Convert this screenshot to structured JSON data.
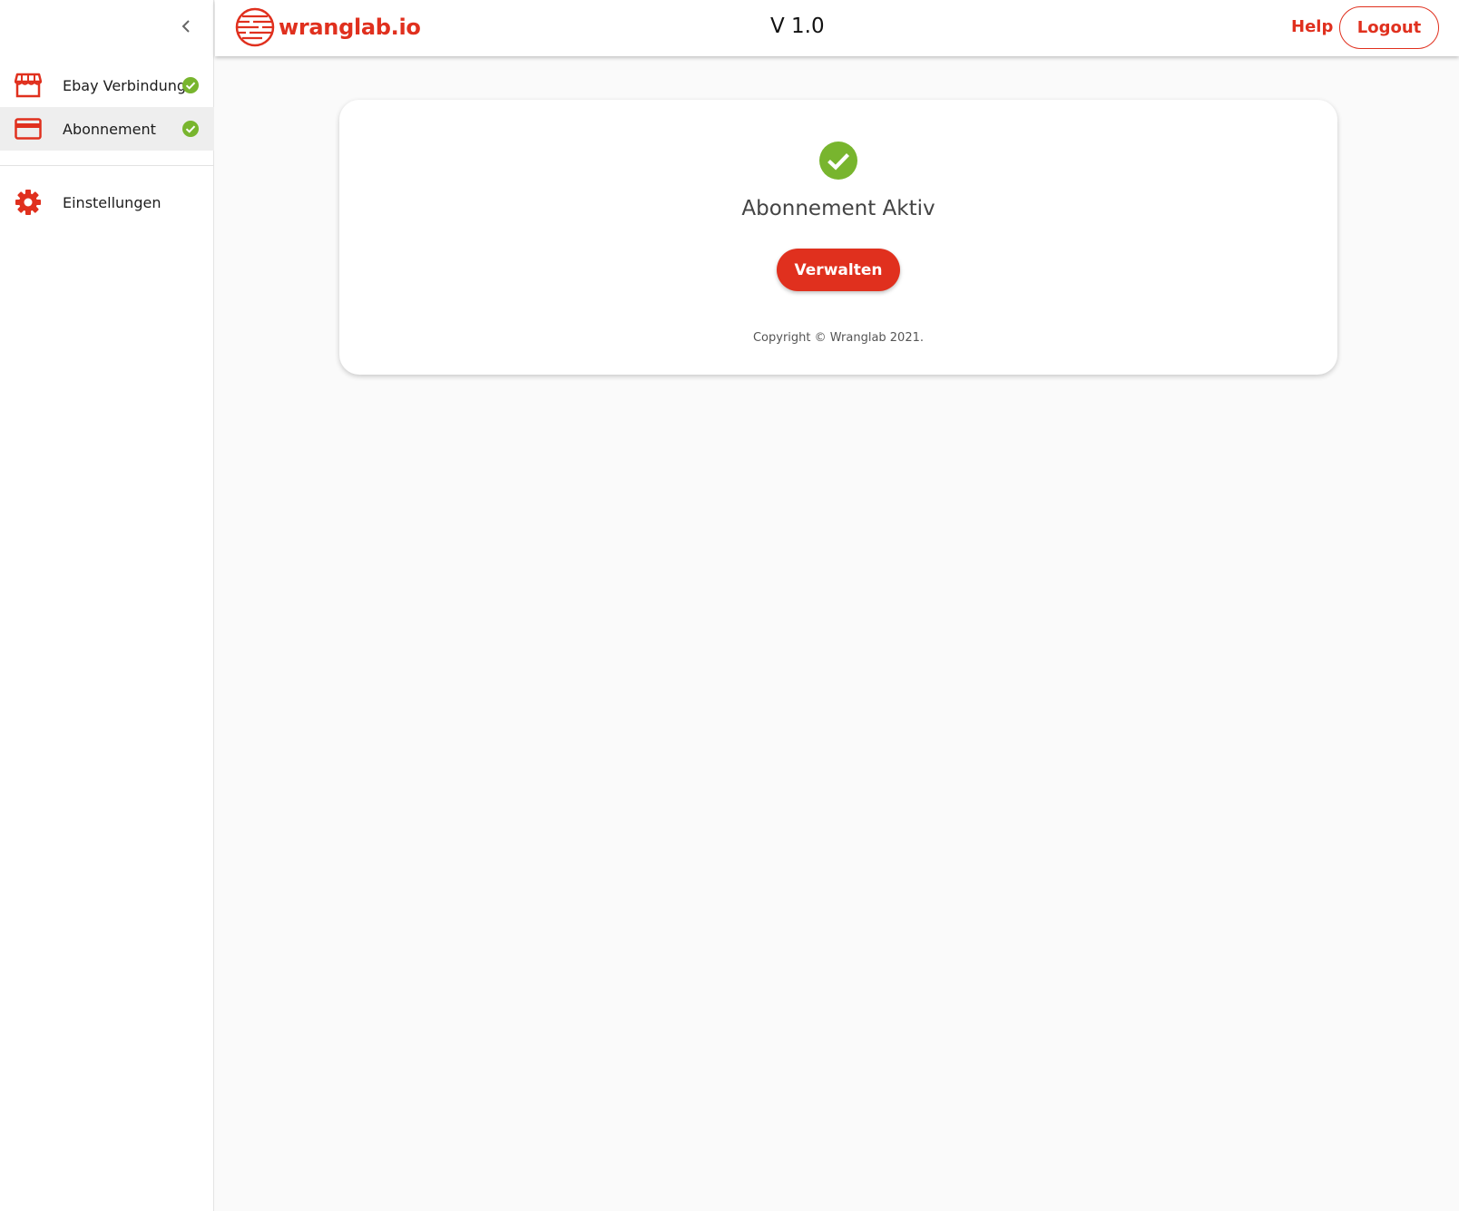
{
  "sidebar": {
    "collapse_icon": "chevron-left-icon",
    "items": [
      {
        "label": "Ebay Verbindung",
        "icon": "store-icon",
        "status": "check-circle-icon",
        "active": false
      },
      {
        "label": "Abonnement",
        "icon": "credit-card-icon",
        "status": "check-circle-icon",
        "active": true
      }
    ],
    "settings": {
      "label": "Einstellungen",
      "icon": "gear-icon"
    }
  },
  "header": {
    "logo_text": "wranglab.io",
    "version": "V 1.0",
    "help_label": "Help",
    "logout_label": "Logout"
  },
  "subscription": {
    "status_icon": "check-circle-icon",
    "status_text": "Abonnement Aktiv",
    "manage_label": "Verwalten",
    "copyright": "Copyright © Wranglab 2021."
  },
  "colors": {
    "accent": "#e0301e",
    "success": "#78b52e",
    "background": "#fafafa"
  }
}
